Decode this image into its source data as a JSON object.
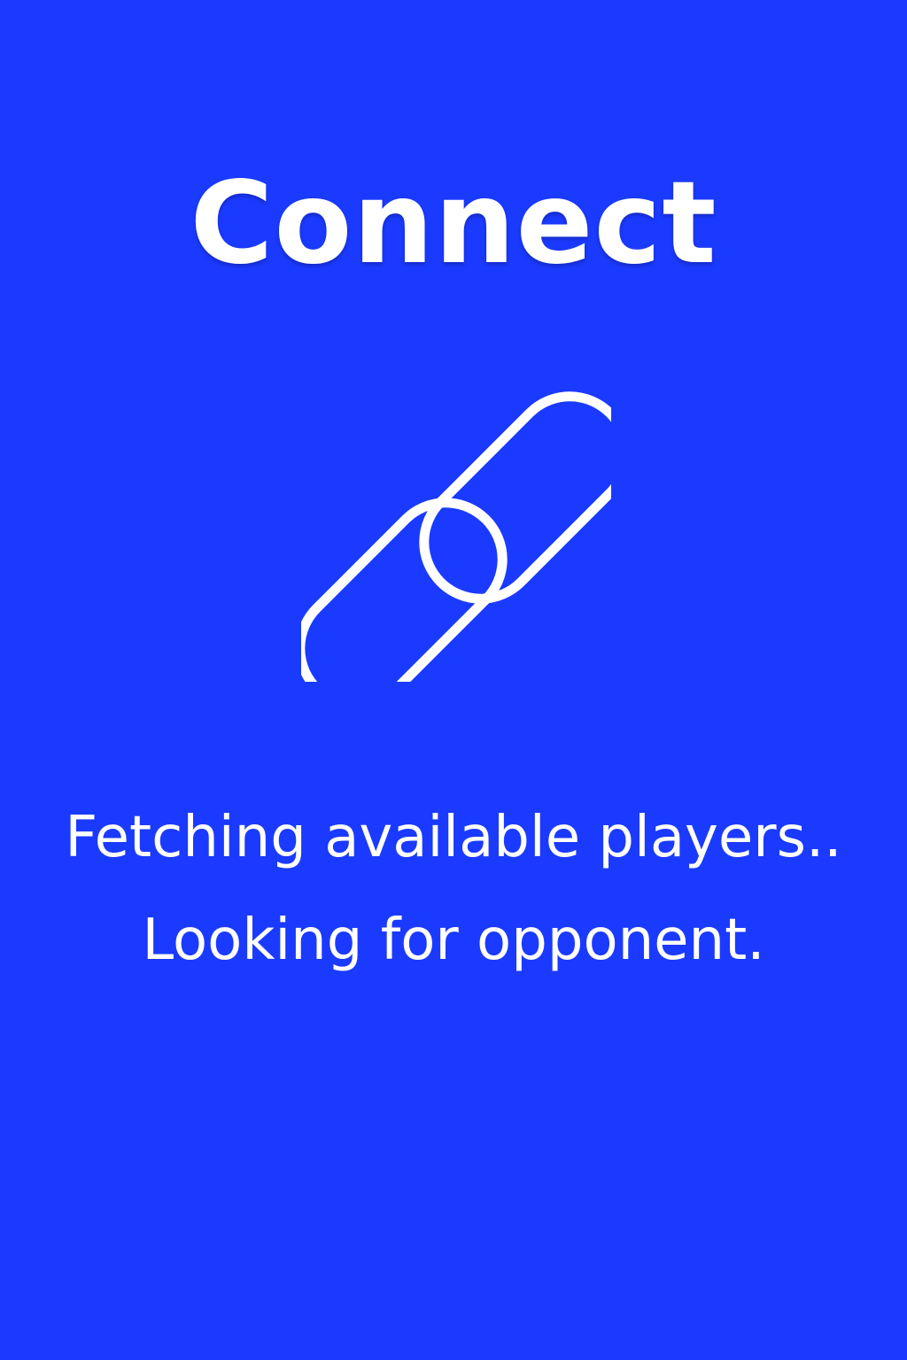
{
  "screen": {
    "title": "Connect",
    "icon": "link-icon",
    "status_lines": [
      "Fetching available players..",
      "Looking for opponent."
    ]
  },
  "colors": {
    "background": "#1b3aff",
    "foreground": "#ffffff"
  }
}
